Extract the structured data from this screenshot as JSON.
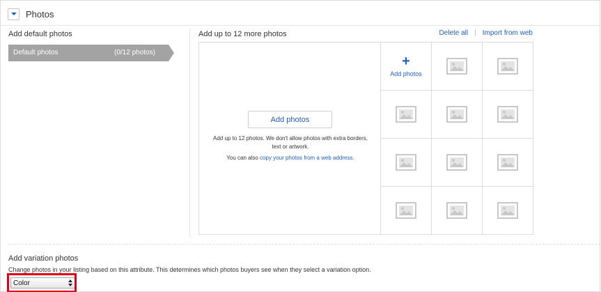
{
  "section": {
    "title": "Photos",
    "collapse_icon": "chevron-down-icon"
  },
  "left": {
    "title": "Add default photos",
    "default_tab_label": "Default photos",
    "default_tab_count": "(0/12 photos)",
    "tab_color": "#a3a3a3"
  },
  "right": {
    "title": "Add up to 12 more photos",
    "delete_all": "Delete all",
    "import_from_web": "Import from web",
    "separator": "|"
  },
  "dropzone": {
    "button_label": "Add photos",
    "help_text": "Add up to 12 photos. We don't allow photos with extra borders, text or artwork.",
    "web_prefix": "You can also ",
    "web_link": "copy your photos from a web address",
    "web_suffix": "."
  },
  "grid": {
    "add_cell": {
      "icon": "plus-icon",
      "plus": "+",
      "label": "Add photos"
    },
    "placeholder_icon": "image-placeholder-icon",
    "placeholder_count": 11
  },
  "variation": {
    "title": "Add variation photos",
    "description": "Change photos in your listing based on this attribute. This determines which photos buyers see when they select a variation option.",
    "select_value": "Color",
    "highlight_color": "#e0001a"
  },
  "colors": {
    "link": "#1f5fc1",
    "border": "#dcdcdc"
  }
}
